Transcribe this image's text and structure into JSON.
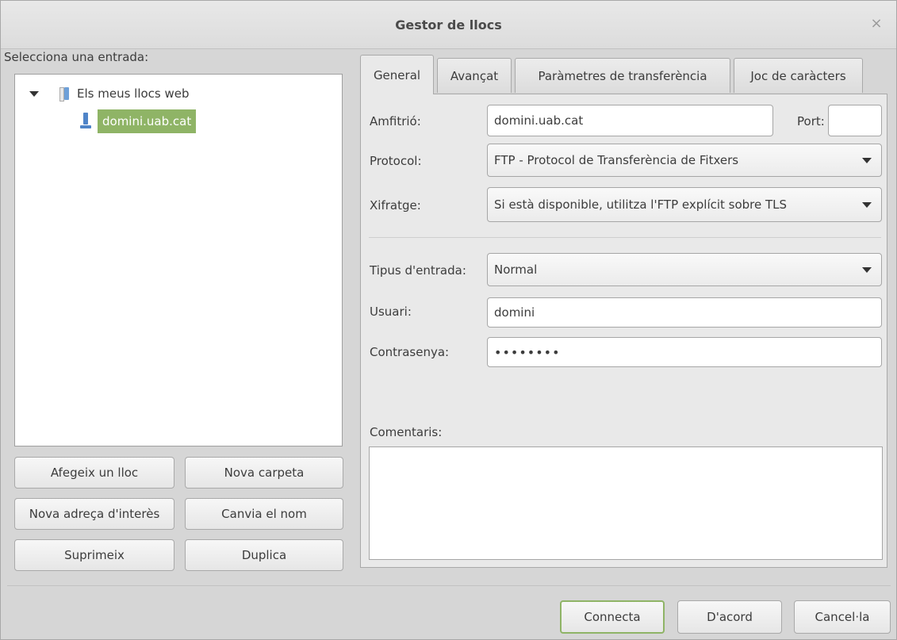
{
  "window": {
    "title": "Gestor de llocs",
    "close_glyph": "×"
  },
  "left": {
    "select_label": "Selecciona una entrada:",
    "tree": {
      "root": {
        "label": "Els meus llocs web",
        "icon": "folder-icon",
        "expanded": true
      },
      "children": [
        {
          "label": "domini.uab.cat",
          "icon": "server-icon",
          "selected": true
        }
      ]
    },
    "buttons": {
      "add_site": "Afegeix un lloc",
      "new_folder": "Nova carpeta",
      "new_bookmark": "Nova adreça d'interès",
      "rename": "Canvia el nom",
      "delete": "Suprimeix",
      "duplicate": "Duplica"
    }
  },
  "tabs": [
    {
      "label": "General",
      "active": true
    },
    {
      "label": "Avançat",
      "active": false
    },
    {
      "label": "Paràmetres de transferència",
      "active": false
    },
    {
      "label": "Joc de caràcters",
      "active": false
    }
  ],
  "general": {
    "host_label": "Amfitrió:",
    "host_value": "domini.uab.cat",
    "port_label": "Port:",
    "port_value": "",
    "protocol_label": "Protocol:",
    "protocol_value": "FTP - Protocol de Transferència de Fitxers",
    "encryption_label": "Xifratge:",
    "encryption_value": "Si està disponible, utilitza l'FTP explícit sobre TLS",
    "logon_type_label": "Tipus d'entrada:",
    "logon_type_value": "Normal",
    "user_label": "Usuari:",
    "user_value": "domini",
    "password_label": "Contrasenya:",
    "password_value": "••••••••",
    "comments_label": "Comentaris:",
    "comments_value": ""
  },
  "footer": {
    "connect": "Connecta",
    "ok": "D'acord",
    "cancel": "Cancel·la"
  },
  "colors": {
    "selection": "#8fb466",
    "background": "#d6d6d6"
  }
}
